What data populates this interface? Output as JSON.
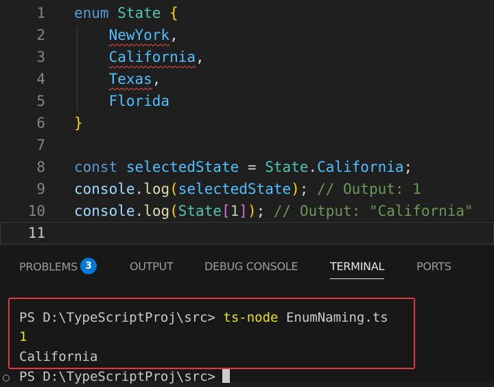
{
  "editor": {
    "lines": [
      {
        "n": "1",
        "tokens": [
          [
            "enum",
            "kw"
          ],
          [
            " ",
            "pn"
          ],
          [
            "State",
            "ty"
          ],
          [
            " ",
            "pn"
          ],
          [
            "{",
            "br"
          ]
        ]
      },
      {
        "n": "2",
        "tokens": [
          [
            "    ",
            "pn"
          ],
          [
            "NewYork",
            "em sq"
          ],
          [
            ",",
            "pn"
          ]
        ]
      },
      {
        "n": "3",
        "tokens": [
          [
            "    ",
            "pn"
          ],
          [
            "California",
            "em sq"
          ],
          [
            ",",
            "pn"
          ]
        ]
      },
      {
        "n": "4",
        "tokens": [
          [
            "    ",
            "pn"
          ],
          [
            "Texas",
            "em sq"
          ],
          [
            ",",
            "pn"
          ]
        ]
      },
      {
        "n": "5",
        "tokens": [
          [
            "    ",
            "pn"
          ],
          [
            "Florida",
            "em"
          ]
        ]
      },
      {
        "n": "6",
        "tokens": [
          [
            "}",
            "br"
          ]
        ]
      },
      {
        "n": "7",
        "tokens": []
      },
      {
        "n": "8",
        "tokens": [
          [
            "const",
            "kw"
          ],
          [
            " ",
            "pn"
          ],
          [
            "selectedState",
            "em"
          ],
          [
            " = ",
            "pn"
          ],
          [
            "State",
            "ty"
          ],
          [
            ".",
            "pn"
          ],
          [
            "California",
            "em"
          ],
          [
            ";",
            "pn"
          ]
        ]
      },
      {
        "n": "9",
        "tokens": [
          [
            "console",
            "vr"
          ],
          [
            ".",
            "pn"
          ],
          [
            "log",
            "fn"
          ],
          [
            "(",
            "br"
          ],
          [
            "selectedState",
            "em"
          ],
          [
            ")",
            "br"
          ],
          [
            "; ",
            "pn"
          ],
          [
            "// Output: 1",
            "cm"
          ]
        ]
      },
      {
        "n": "10",
        "tokens": [
          [
            "console",
            "vr"
          ],
          [
            ".",
            "pn"
          ],
          [
            "log",
            "fn"
          ],
          [
            "(",
            "br"
          ],
          [
            "State",
            "ty"
          ],
          [
            "[",
            "br2"
          ],
          [
            "1",
            "nm"
          ],
          [
            "]",
            "br2"
          ],
          [
            ")",
            "br"
          ],
          [
            "; ",
            "pn"
          ],
          [
            "// Output: \"California\"",
            "cm"
          ]
        ]
      },
      {
        "n": "11",
        "tokens": []
      }
    ]
  },
  "panel": {
    "tabs": {
      "problems": "PROBLEMS",
      "problems_count": "3",
      "output": "OUTPUT",
      "debug_console": "DEBUG CONSOLE",
      "terminal": "TERMINAL",
      "ports": "PORTS"
    },
    "terminal": {
      "prompt1": "PS D:\\TypeScriptProj\\src> ",
      "command": "ts-node",
      "argument": " EnumNaming.ts",
      "output1": "1",
      "output2": "California",
      "prompt2": "PS D:\\TypeScriptProj\\src>"
    }
  },
  "colors": {
    "accent": "#0078d4",
    "highlight_box": "#e23b3b",
    "squiggle": "#f14c4c"
  }
}
